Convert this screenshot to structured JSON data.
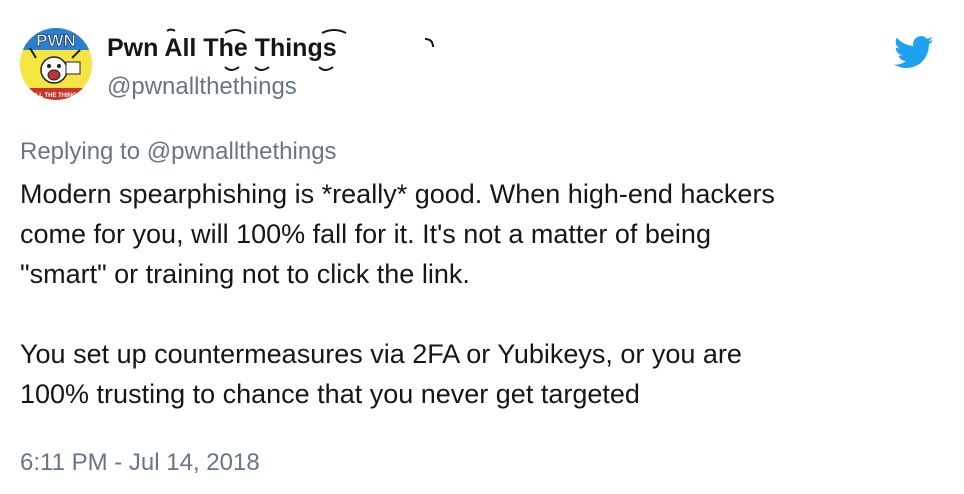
{
  "author": {
    "display_name": "Pwn All The Things",
    "handle": "@pwnallthethings",
    "avatar_icon": "pwn-meme-avatar",
    "avatar_text_top": "PWN",
    "avatar_text_bottom": "ALL THE THINGS"
  },
  "brand": {
    "icon": "twitter-bird-icon",
    "color": "#1da1f2"
  },
  "reply": {
    "prefix": "Replying to",
    "to_handle": "@pwnallthethings"
  },
  "body": {
    "lines": [
      "Modern spearphishing is *really* good. When high-end hackers",
      "come for you, will 100% fall for it. It's not a matter of being",
      "\"smart\" or training not to click the link.",
      "",
      "You set up countermeasures via 2FA or Yubikeys, or you are",
      "100% trusting to chance that you never get targeted"
    ]
  },
  "timestamp": "6:11 PM - Jul 14, 2018",
  "colors": {
    "text": "#14171a",
    "secondary": "#657786"
  }
}
